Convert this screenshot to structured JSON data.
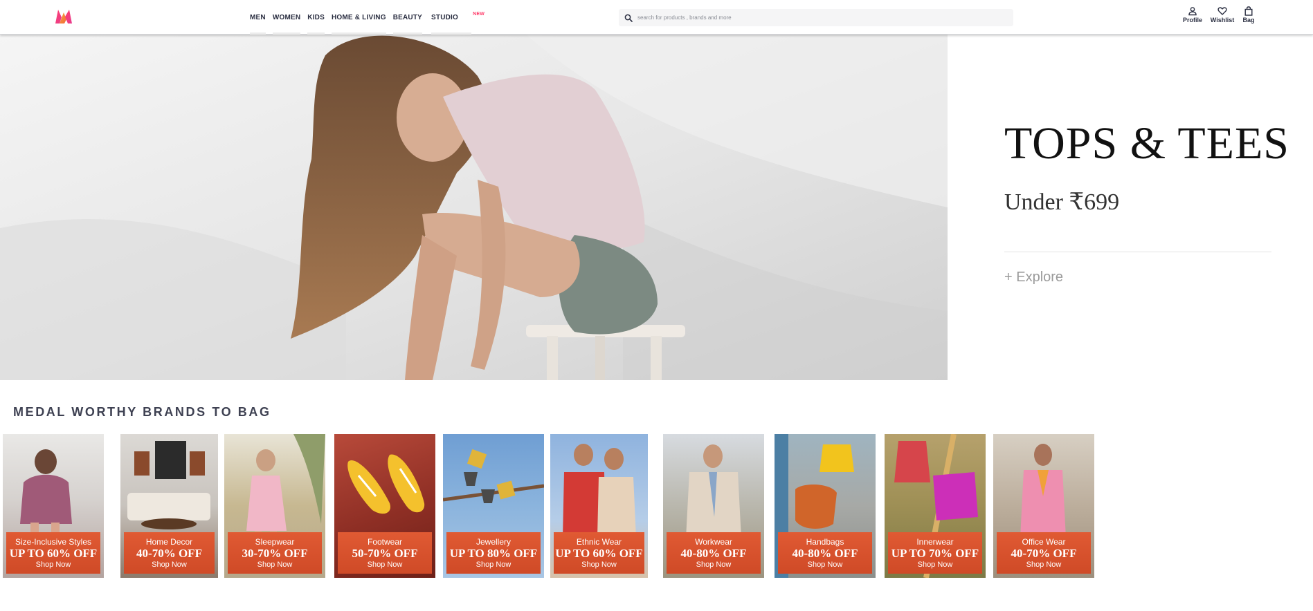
{
  "header": {
    "nav": [
      {
        "label": "MEN"
      },
      {
        "label": "WOMEN"
      },
      {
        "label": "KIDS"
      },
      {
        "label": "HOME & LIVING"
      },
      {
        "label": "BEAUTY"
      },
      {
        "label": "STUDIO",
        "badge": "NEW"
      }
    ],
    "search": {
      "placeholder": "search for products , brands and more"
    },
    "actions": {
      "profile": "Profile",
      "wishlist": "Wishlist",
      "bag": "Bag"
    },
    "brand_colors": {
      "logo_pink": "#ff3f6c",
      "logo_orange": "#f7a23b",
      "badge": "#ff3f6c"
    }
  },
  "hero": {
    "title": "TOPS & TEES",
    "subtitle": "Under ₹699",
    "cta": "+ Explore"
  },
  "section": {
    "title": "MEDAL WORTHY BRANDS TO BAG",
    "tiles": [
      {
        "category": "Size-Inclusive Styles",
        "offer": "UP TO 60% OFF",
        "cta": "Shop Now"
      },
      {
        "category": "Home Decor",
        "offer": "40-70% OFF",
        "cta": "Shop Now"
      },
      {
        "category": "Sleepwear",
        "offer": "30-70% OFF",
        "cta": "Shop Now"
      },
      {
        "category": "Footwear",
        "offer": "50-70% OFF",
        "cta": "Shop Now"
      },
      {
        "category": "Jewellery",
        "offer": "UP TO 80% OFF",
        "cta": "Shop Now"
      },
      {
        "category": "Ethnic Wear",
        "offer": "UP TO 60% OFF",
        "cta": "Shop Now"
      },
      {
        "category": "Workwear",
        "offer": "40-80% OFF",
        "cta": "Shop Now"
      },
      {
        "category": "Handbags",
        "offer": "40-80% OFF",
        "cta": "Shop Now"
      },
      {
        "category": "Innerwear",
        "offer": "UP TO 70% OFF",
        "cta": "Shop Now"
      },
      {
        "category": "Office Wear",
        "offer": "40-70% OFF",
        "cta": "Shop Now"
      }
    ],
    "badge_color": "#d8502c"
  }
}
